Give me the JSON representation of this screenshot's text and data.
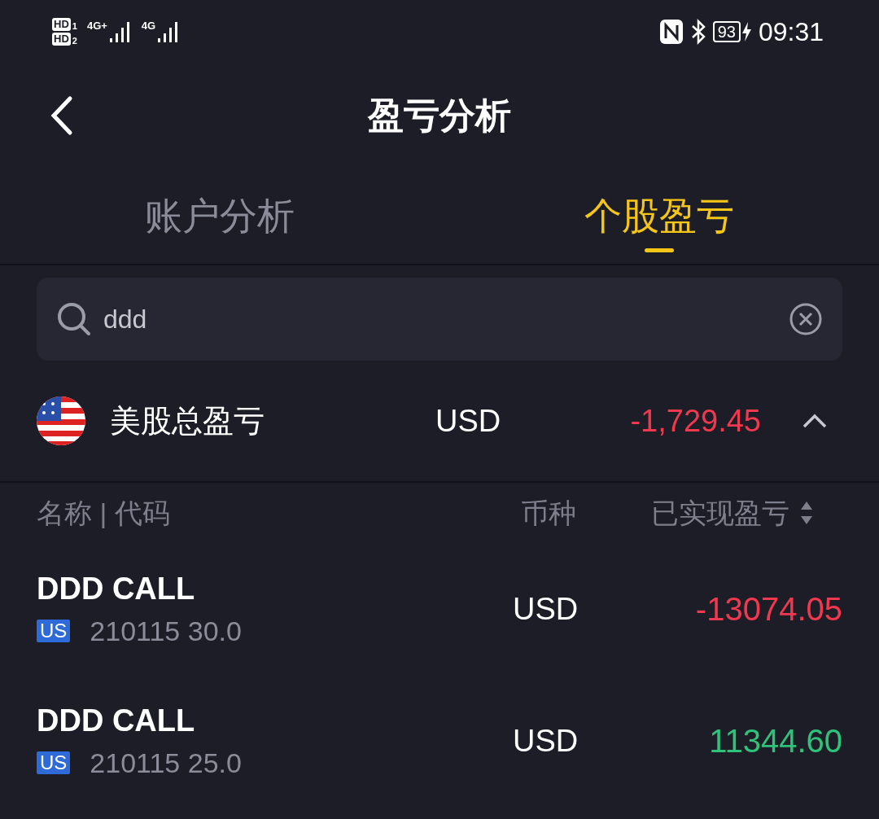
{
  "status_bar": {
    "sim": [
      {
        "hd": "HD",
        "slot": "1",
        "network": "4G+"
      },
      {
        "hd": "HD",
        "slot": "2",
        "network": "4G"
      }
    ],
    "battery": "93",
    "time": "09:31"
  },
  "header": {
    "title": "盈亏分析"
  },
  "tabs": [
    {
      "label": "账户分析",
      "selected": false
    },
    {
      "label": "个股盈亏",
      "selected": true
    }
  ],
  "search": {
    "value": "ddd"
  },
  "summary": {
    "title": "美股总盈亏",
    "currency": "USD",
    "value": "-1,729.45",
    "expanded": true
  },
  "table": {
    "columns": [
      "名称 | 代码",
      "币种",
      "已实现盈亏"
    ],
    "rows": [
      {
        "name": "DDD CALL",
        "market": "US",
        "code": "210115 30.0",
        "currency": "USD",
        "pnl": "-13074.05",
        "kind": "loss"
      },
      {
        "name": "DDD CALL",
        "market": "US",
        "code": "210115 25.0",
        "currency": "USD",
        "pnl": "11344.60",
        "kind": "gain"
      }
    ]
  }
}
